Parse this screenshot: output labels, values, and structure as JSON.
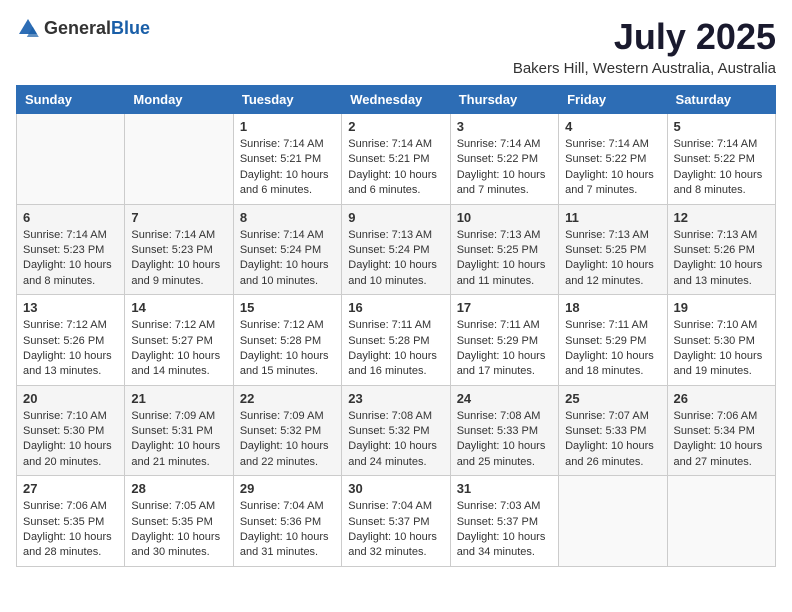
{
  "logo": {
    "general": "General",
    "blue": "Blue"
  },
  "title": {
    "month": "July 2025",
    "location": "Bakers Hill, Western Australia, Australia"
  },
  "days_of_week": [
    "Sunday",
    "Monday",
    "Tuesday",
    "Wednesday",
    "Thursday",
    "Friday",
    "Saturday"
  ],
  "weeks": [
    [
      {
        "day": "",
        "sunrise": "",
        "sunset": "",
        "daylight": ""
      },
      {
        "day": "",
        "sunrise": "",
        "sunset": "",
        "daylight": ""
      },
      {
        "day": "1",
        "sunrise": "Sunrise: 7:14 AM",
        "sunset": "Sunset: 5:21 PM",
        "daylight": "Daylight: 10 hours and 6 minutes."
      },
      {
        "day": "2",
        "sunrise": "Sunrise: 7:14 AM",
        "sunset": "Sunset: 5:21 PM",
        "daylight": "Daylight: 10 hours and 6 minutes."
      },
      {
        "day": "3",
        "sunrise": "Sunrise: 7:14 AM",
        "sunset": "Sunset: 5:22 PM",
        "daylight": "Daylight: 10 hours and 7 minutes."
      },
      {
        "day": "4",
        "sunrise": "Sunrise: 7:14 AM",
        "sunset": "Sunset: 5:22 PM",
        "daylight": "Daylight: 10 hours and 7 minutes."
      },
      {
        "day": "5",
        "sunrise": "Sunrise: 7:14 AM",
        "sunset": "Sunset: 5:22 PM",
        "daylight": "Daylight: 10 hours and 8 minutes."
      }
    ],
    [
      {
        "day": "6",
        "sunrise": "Sunrise: 7:14 AM",
        "sunset": "Sunset: 5:23 PM",
        "daylight": "Daylight: 10 hours and 8 minutes."
      },
      {
        "day": "7",
        "sunrise": "Sunrise: 7:14 AM",
        "sunset": "Sunset: 5:23 PM",
        "daylight": "Daylight: 10 hours and 9 minutes."
      },
      {
        "day": "8",
        "sunrise": "Sunrise: 7:14 AM",
        "sunset": "Sunset: 5:24 PM",
        "daylight": "Daylight: 10 hours and 10 minutes."
      },
      {
        "day": "9",
        "sunrise": "Sunrise: 7:13 AM",
        "sunset": "Sunset: 5:24 PM",
        "daylight": "Daylight: 10 hours and 10 minutes."
      },
      {
        "day": "10",
        "sunrise": "Sunrise: 7:13 AM",
        "sunset": "Sunset: 5:25 PM",
        "daylight": "Daylight: 10 hours and 11 minutes."
      },
      {
        "day": "11",
        "sunrise": "Sunrise: 7:13 AM",
        "sunset": "Sunset: 5:25 PM",
        "daylight": "Daylight: 10 hours and 12 minutes."
      },
      {
        "day": "12",
        "sunrise": "Sunrise: 7:13 AM",
        "sunset": "Sunset: 5:26 PM",
        "daylight": "Daylight: 10 hours and 13 minutes."
      }
    ],
    [
      {
        "day": "13",
        "sunrise": "Sunrise: 7:12 AM",
        "sunset": "Sunset: 5:26 PM",
        "daylight": "Daylight: 10 hours and 13 minutes."
      },
      {
        "day": "14",
        "sunrise": "Sunrise: 7:12 AM",
        "sunset": "Sunset: 5:27 PM",
        "daylight": "Daylight: 10 hours and 14 minutes."
      },
      {
        "day": "15",
        "sunrise": "Sunrise: 7:12 AM",
        "sunset": "Sunset: 5:28 PM",
        "daylight": "Daylight: 10 hours and 15 minutes."
      },
      {
        "day": "16",
        "sunrise": "Sunrise: 7:11 AM",
        "sunset": "Sunset: 5:28 PM",
        "daylight": "Daylight: 10 hours and 16 minutes."
      },
      {
        "day": "17",
        "sunrise": "Sunrise: 7:11 AM",
        "sunset": "Sunset: 5:29 PM",
        "daylight": "Daylight: 10 hours and 17 minutes."
      },
      {
        "day": "18",
        "sunrise": "Sunrise: 7:11 AM",
        "sunset": "Sunset: 5:29 PM",
        "daylight": "Daylight: 10 hours and 18 minutes."
      },
      {
        "day": "19",
        "sunrise": "Sunrise: 7:10 AM",
        "sunset": "Sunset: 5:30 PM",
        "daylight": "Daylight: 10 hours and 19 minutes."
      }
    ],
    [
      {
        "day": "20",
        "sunrise": "Sunrise: 7:10 AM",
        "sunset": "Sunset: 5:30 PM",
        "daylight": "Daylight: 10 hours and 20 minutes."
      },
      {
        "day": "21",
        "sunrise": "Sunrise: 7:09 AM",
        "sunset": "Sunset: 5:31 PM",
        "daylight": "Daylight: 10 hours and 21 minutes."
      },
      {
        "day": "22",
        "sunrise": "Sunrise: 7:09 AM",
        "sunset": "Sunset: 5:32 PM",
        "daylight": "Daylight: 10 hours and 22 minutes."
      },
      {
        "day": "23",
        "sunrise": "Sunrise: 7:08 AM",
        "sunset": "Sunset: 5:32 PM",
        "daylight": "Daylight: 10 hours and 24 minutes."
      },
      {
        "day": "24",
        "sunrise": "Sunrise: 7:08 AM",
        "sunset": "Sunset: 5:33 PM",
        "daylight": "Daylight: 10 hours and 25 minutes."
      },
      {
        "day": "25",
        "sunrise": "Sunrise: 7:07 AM",
        "sunset": "Sunset: 5:33 PM",
        "daylight": "Daylight: 10 hours and 26 minutes."
      },
      {
        "day": "26",
        "sunrise": "Sunrise: 7:06 AM",
        "sunset": "Sunset: 5:34 PM",
        "daylight": "Daylight: 10 hours and 27 minutes."
      }
    ],
    [
      {
        "day": "27",
        "sunrise": "Sunrise: 7:06 AM",
        "sunset": "Sunset: 5:35 PM",
        "daylight": "Daylight: 10 hours and 28 minutes."
      },
      {
        "day": "28",
        "sunrise": "Sunrise: 7:05 AM",
        "sunset": "Sunset: 5:35 PM",
        "daylight": "Daylight: 10 hours and 30 minutes."
      },
      {
        "day": "29",
        "sunrise": "Sunrise: 7:04 AM",
        "sunset": "Sunset: 5:36 PM",
        "daylight": "Daylight: 10 hours and 31 minutes."
      },
      {
        "day": "30",
        "sunrise": "Sunrise: 7:04 AM",
        "sunset": "Sunset: 5:37 PM",
        "daylight": "Daylight: 10 hours and 32 minutes."
      },
      {
        "day": "31",
        "sunrise": "Sunrise: 7:03 AM",
        "sunset": "Sunset: 5:37 PM",
        "daylight": "Daylight: 10 hours and 34 minutes."
      },
      {
        "day": "",
        "sunrise": "",
        "sunset": "",
        "daylight": ""
      },
      {
        "day": "",
        "sunrise": "",
        "sunset": "",
        "daylight": ""
      }
    ]
  ]
}
